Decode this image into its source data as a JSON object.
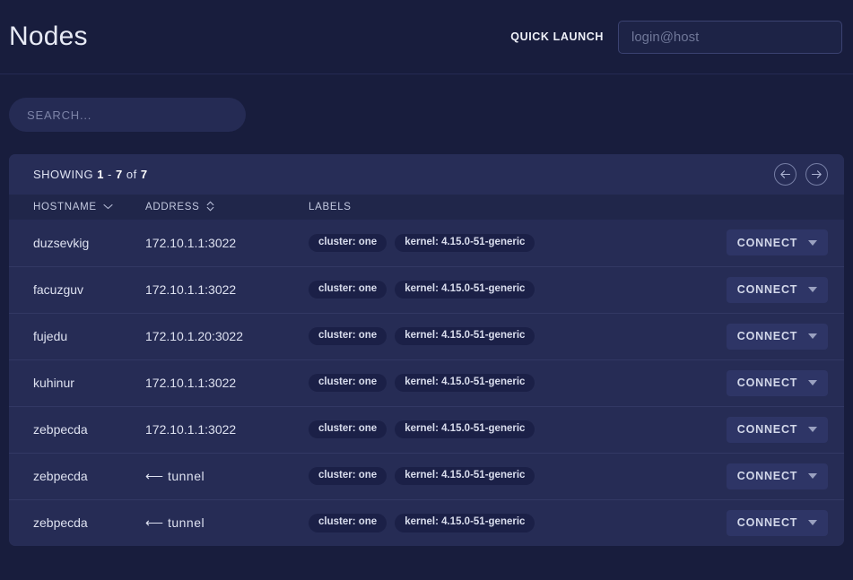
{
  "header": {
    "title": "Nodes",
    "quick_launch_label": "QUICK LAUNCH",
    "quick_launch_placeholder": "login@host",
    "quick_launch_value": ""
  },
  "search": {
    "placeholder": "SEARCH...",
    "value": ""
  },
  "table_card": {
    "showing_prefix": "SHOWING",
    "showing_from": "1",
    "showing_dash": "-",
    "showing_to": "7",
    "showing_of": "of",
    "showing_total": "7",
    "pager": {
      "prev_icon": "arrow-left-circle-icon",
      "next_icon": "arrow-right-circle-icon"
    },
    "columns": [
      {
        "label": "HOSTNAME",
        "sort_icon": "chevron-down-icon"
      },
      {
        "label": "ADDRESS",
        "sort_icon": "chevron-up-down-icon"
      },
      {
        "label": "LABELS",
        "sort_icon": ""
      },
      {
        "label": "",
        "sort_icon": ""
      }
    ],
    "rows": [
      {
        "hostname": "duzsevkig",
        "address": "172.10.1.1:3022",
        "labels": [
          "cluster: one",
          "kernel: 4.15.0-51-generic"
        ],
        "action": "CONNECT"
      },
      {
        "hostname": "facuzguv",
        "address": "172.10.1.1:3022",
        "labels": [
          "cluster: one",
          "kernel: 4.15.0-51-generic"
        ],
        "action": "CONNECT"
      },
      {
        "hostname": "fujedu",
        "address": "172.10.1.20:3022",
        "labels": [
          "cluster: one",
          "kernel: 4.15.0-51-generic"
        ],
        "action": "CONNECT"
      },
      {
        "hostname": "kuhinur",
        "address": "172.10.1.1:3022",
        "labels": [
          "cluster: one",
          "kernel: 4.15.0-51-generic"
        ],
        "action": "CONNECT"
      },
      {
        "hostname": "zebpecda",
        "address": "172.10.1.1:3022",
        "labels": [
          "cluster: one",
          "kernel: 4.15.0-51-generic"
        ],
        "action": "CONNECT"
      },
      {
        "hostname": "zebpecda",
        "address": "⟵ tunnel",
        "labels": [
          "cluster: one",
          "kernel: 4.15.0-51-generic"
        ],
        "action": "CONNECT"
      },
      {
        "hostname": "zebpecda",
        "address": "⟵ tunnel",
        "labels": [
          "cluster: one",
          "kernel: 4.15.0-51-generic"
        ],
        "action": "CONNECT"
      }
    ]
  },
  "colors": {
    "page_background": "#181d3d",
    "card_background": "#242a52",
    "row_background": "#262c55",
    "column_header_background": "#20264a",
    "chip_background": "#1b2047",
    "button_background": "#2e3566",
    "text_primary": "#dde1f0",
    "text_muted": "#7d84a8"
  }
}
